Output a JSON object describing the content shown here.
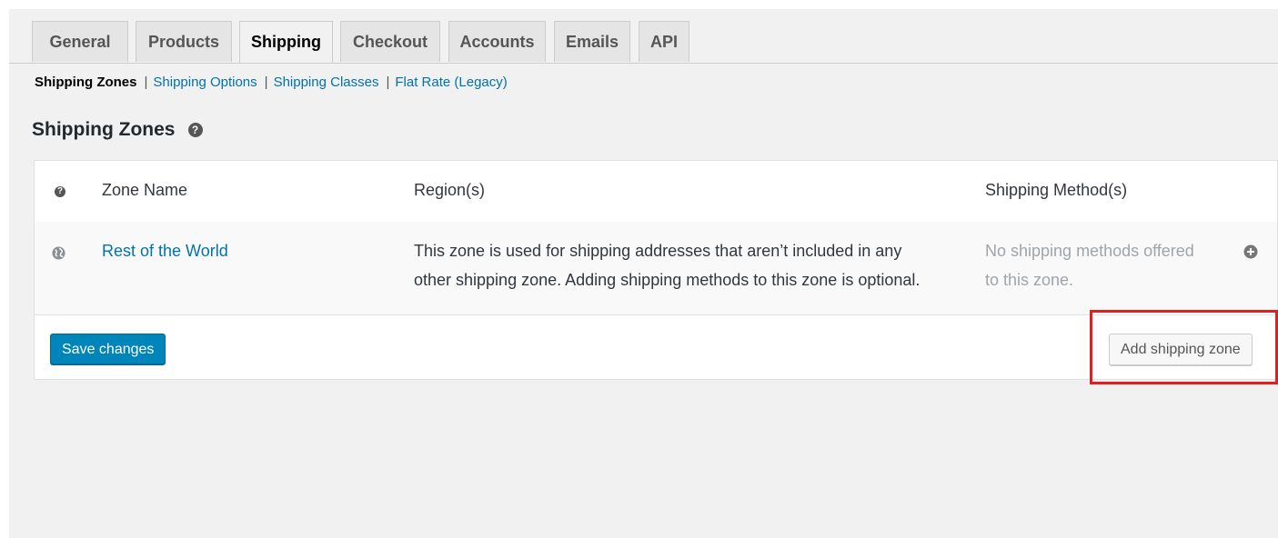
{
  "tabs": [
    {
      "label": "General",
      "active": false
    },
    {
      "label": "Products",
      "active": false
    },
    {
      "label": "Shipping",
      "active": true
    },
    {
      "label": "Checkout",
      "active": false
    },
    {
      "label": "Accounts",
      "active": false
    },
    {
      "label": "Emails",
      "active": false
    },
    {
      "label": "API",
      "active": false
    }
  ],
  "subnav": {
    "current": "Shipping Zones",
    "links": [
      "Shipping Options",
      "Shipping Classes",
      "Flat Rate (Legacy)"
    ],
    "separator": "|"
  },
  "heading": {
    "title": "Shipping Zones",
    "help_icon": "help-icon"
  },
  "table": {
    "columns": [
      "Zone Name",
      "Region(s)",
      "Shipping Method(s)"
    ],
    "rows": [
      {
        "icon": "globe-icon",
        "zone_name": "Rest of the World",
        "region_line1": "This zone is used for shipping addresses that aren’t included in any",
        "region_line2": "other shipping zone. Adding shipping methods to this zone is optional.",
        "methods_line1": "No shipping methods offered",
        "methods_line2": "to this zone.",
        "action_icon": "plus-circle-icon"
      }
    ]
  },
  "buttons": {
    "save": "Save changes",
    "add_zone": "Add shipping zone"
  },
  "colors": {
    "link": "#0073aa",
    "primary_button": "#0085ba",
    "highlight": "#e02020",
    "muted_text": "#a0a5aa"
  }
}
